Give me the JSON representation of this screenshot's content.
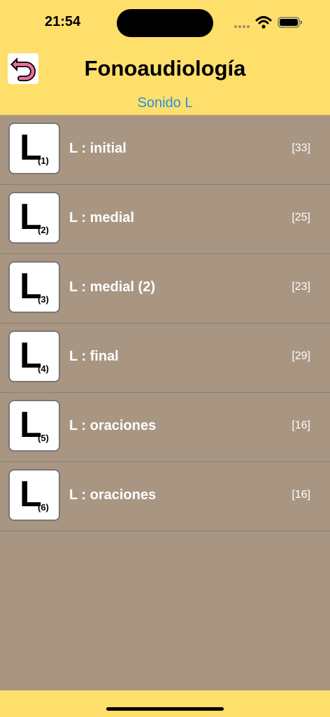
{
  "status_bar": {
    "time": "21:54"
  },
  "header": {
    "title": "Fonoaudiología",
    "subtitle": "Sonido L",
    "back_icon": "undo-arrow-icon"
  },
  "items": [
    {
      "letter": "L",
      "index": "(1)",
      "label": "L : initial",
      "count": "[33]"
    },
    {
      "letter": "L",
      "index": "(2)",
      "label": "L : medial",
      "count": "[25]"
    },
    {
      "letter": "L",
      "index": "(3)",
      "label": "L : medial (2)",
      "count": "[23]"
    },
    {
      "letter": "L",
      "index": "(4)",
      "label": "L : final",
      "count": "[29]"
    },
    {
      "letter": "L",
      "index": "(5)",
      "label": "L : oraciones",
      "count": "[16]"
    },
    {
      "letter": "L",
      "index": "(6)",
      "label": "L : oraciones",
      "count": "[16]"
    }
  ],
  "colors": {
    "header_bg": "#ffdf6b",
    "list_bg": "#a89683",
    "subtitle": "#2f8fdc",
    "back_icon": "#e96fa0"
  }
}
